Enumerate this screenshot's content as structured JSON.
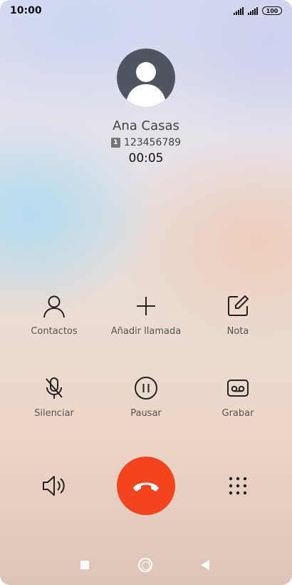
{
  "status_bar": {
    "time": "10:00",
    "battery": "100"
  },
  "caller": {
    "name": "Ana Casas",
    "sim": "1",
    "number": "123456789",
    "duration": "00:05"
  },
  "actions": [
    {
      "label": "Contactos",
      "icon": "person-icon"
    },
    {
      "label": "Añadir llamada",
      "icon": "plus-icon"
    },
    {
      "label": "Nota",
      "icon": "note-edit-icon"
    },
    {
      "label": "Silenciar",
      "icon": "mic-off-icon"
    },
    {
      "label": "Pausar",
      "icon": "pause-icon"
    },
    {
      "label": "Grabar",
      "icon": "record-icon"
    }
  ],
  "controls": {
    "speaker_icon": "speaker-icon",
    "end_call_icon": "hang-up-icon",
    "dialpad_icon": "dialpad-icon",
    "end_call_color": "#f4431f"
  },
  "nav": {
    "recents_icon": "square-icon",
    "home_icon": "circle-icon",
    "back_icon": "triangle-back-icon"
  }
}
